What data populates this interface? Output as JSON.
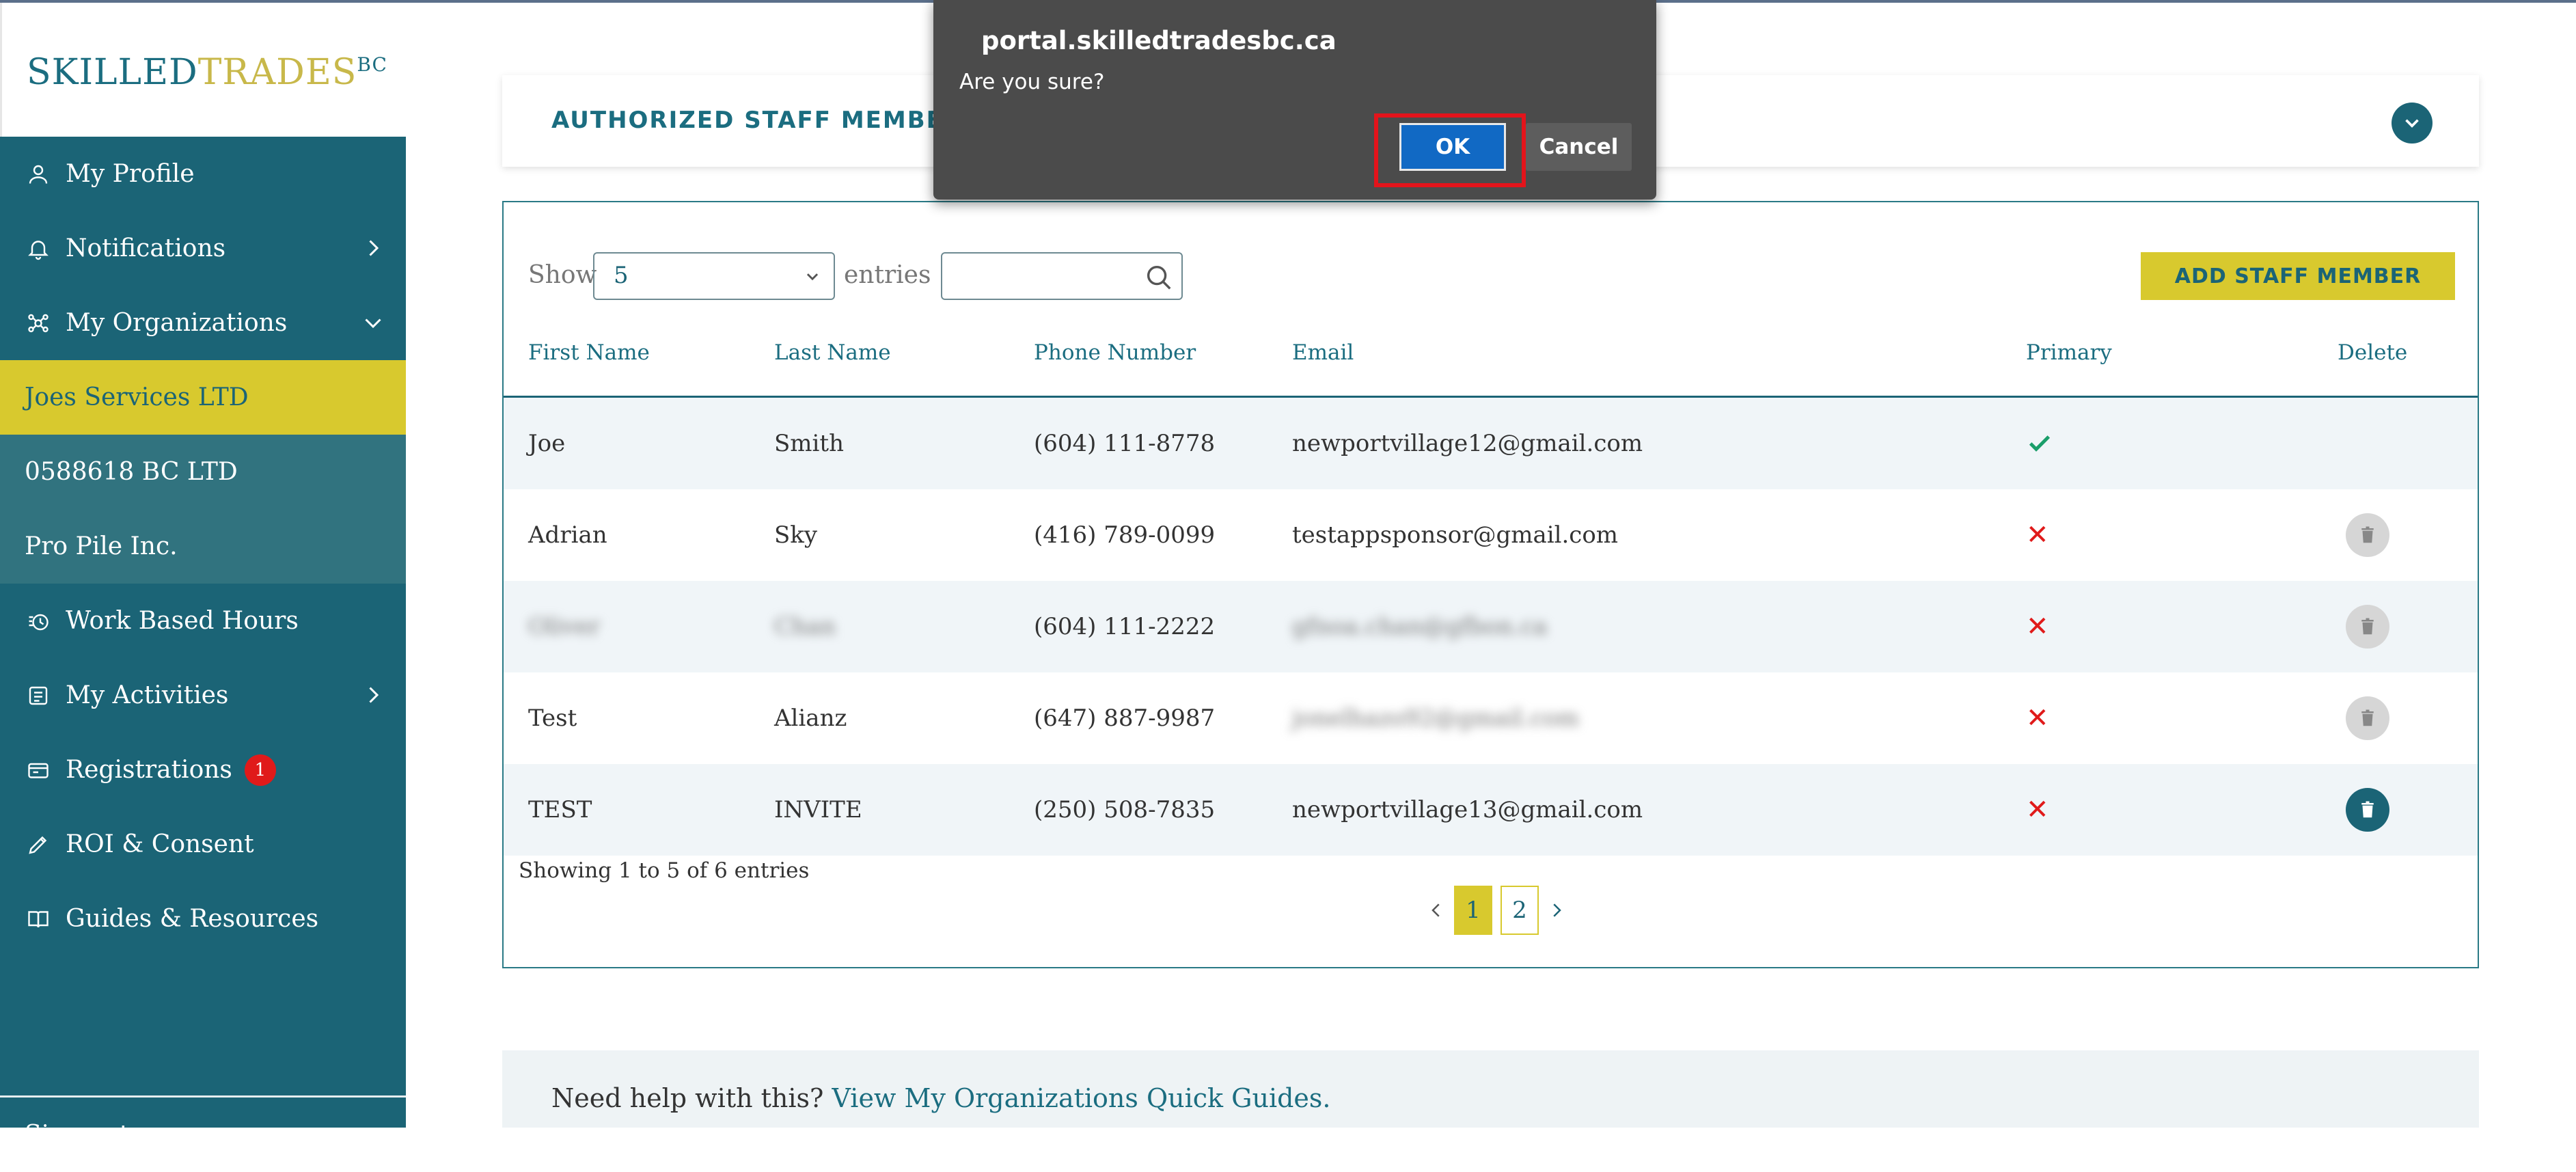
{
  "brand": {
    "logo_part1": "SKILLED",
    "logo_part2": "TRADES",
    "logo_part3": "BC"
  },
  "sidebar": {
    "items": [
      {
        "label": "My Profile",
        "icon": "user-icon"
      },
      {
        "label": "Notifications",
        "icon": "bell-icon"
      },
      {
        "label": "My Organizations",
        "icon": "organizations-icon"
      },
      {
        "label": "Joes Services LTD"
      },
      {
        "label": "0588618 BC LTD"
      },
      {
        "label": "Pro Pile Inc."
      },
      {
        "label": "Work Based Hours",
        "icon": "hours-icon"
      },
      {
        "label": "My Activities",
        "icon": "activities-icon"
      },
      {
        "label": "Registrations",
        "icon": "registrations-icon",
        "badge": "1"
      },
      {
        "label": "ROI & Consent",
        "icon": "pencil-icon"
      },
      {
        "label": "Guides & Resources",
        "icon": "guides-icon"
      },
      {
        "label": "Sign out"
      }
    ]
  },
  "section": {
    "title": "AUTHORIZED STAFF MEMBERS"
  },
  "table": {
    "show_label": "Show",
    "page_size": "5",
    "entries_label": "entries",
    "search_value": "",
    "add_button": "ADD STAFF MEMBER",
    "columns": [
      "First Name",
      "Last Name",
      "Phone Number",
      "Email",
      "Primary",
      "Delete"
    ],
    "rows": [
      {
        "first": "Joe",
        "last": "Smith",
        "phone": "(604) 111-8778",
        "email": "newportvillage12@gmail.com",
        "primary": "✓"
      },
      {
        "first": "Adrian",
        "last": "Sky",
        "phone": "(416) 789-0099",
        "email": "testappsponsor@gmail.com",
        "primary": "✕"
      },
      {
        "first": "Oliver",
        "last": "Chan",
        "phone": "(604) 111-2222",
        "email": "gfnoa.chan@gfbon.ca",
        "primary": "✕"
      },
      {
        "first": "Test",
        "last": "Alianz",
        "phone": "(647) 887-9987",
        "email": "jonelhazo92@gmail.com",
        "primary": "✕"
      },
      {
        "first": "TEST",
        "last": "INVITE",
        "phone": "(250) 508-7835",
        "email": "newportvillage13@gmail.com",
        "primary": "✕"
      }
    ],
    "info": "Showing 1 to 5 of 6 entries",
    "pages": [
      "1",
      "2"
    ]
  },
  "help": {
    "text": "Need help with this? ",
    "link": "View My Organizations Quick Guides."
  },
  "dialog": {
    "title": "portal.skilledtradesbc.ca",
    "message": "Are you sure?",
    "ok": "OK",
    "cancel": "Cancel"
  },
  "colors": {
    "teal": "#1b6476",
    "gold": "#d8c92e",
    "danger": "#e01a1a",
    "success": "#1a9e6a"
  }
}
